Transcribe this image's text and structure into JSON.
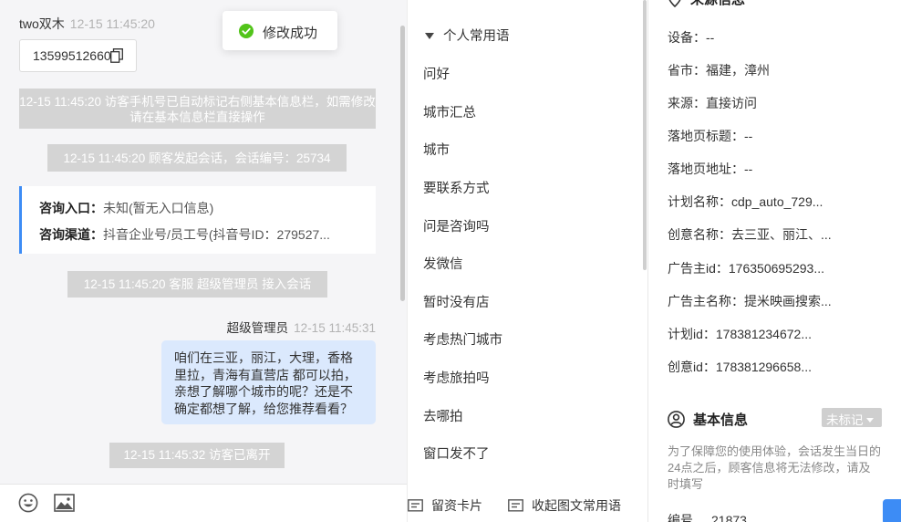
{
  "chat": {
    "visitor_name": "two双木",
    "visitor_time": "12-15 11:45:20",
    "phone": "13599512660",
    "system_messages": [
      "12-15 11:45:20 访客手机号已自动标记右侧基本信息栏，如需修改请在基本信息栏直接操作",
      "12-15 11:45:20 顾客发起会话，会话编号：25734",
      "12-15 11:45:20 客服 超级管理员 接入会话",
      "12-15 11:45:32 访客已离开"
    ],
    "info_card": {
      "entry_label": "咨询入口：",
      "entry_value": "未知(暂无入口信息)",
      "channel_label": "咨询渠道：",
      "channel_value": "抖音企业号/员工号(抖音号ID：279527..."
    },
    "agent_name": "超级管理员",
    "agent_time": "12-15 11:45:31",
    "agent_message": "咱们在三亚，丽江，大理，香格里拉，青海有直营店 都可以拍，亲想了解哪个城市的呢？还是不确定都想了解，给您推荐看看？"
  },
  "toast": {
    "text": "修改成功"
  },
  "icons": {
    "success": "check-circle-icon",
    "copy": "copy-icon",
    "emoji": "emoji-icon",
    "image": "image-icon",
    "card": "card-icon",
    "user": "user-circle-icon"
  },
  "phrases": {
    "group_title": "个人常用语",
    "items": [
      "问好",
      "城市汇总",
      "城市",
      "要联系方式",
      "问是咨询吗",
      "发微信",
      "暂时没有店",
      "考虑热门城市",
      "考虑旅拍吗",
      "去哪拍",
      "窗口发不了"
    ],
    "footer_left": "留资卡片",
    "footer_right": "收起图文常用语"
  },
  "side": {
    "source_title": "来源信息",
    "lines": [
      "设备：--",
      "省市：福建，漳州",
      "来源：直接访问",
      "落地页标题：--",
      "落地页地址：--",
      "计划名称：cdp_auto_729...",
      "创意名称：去三亚、丽江、...",
      "广告主id：176350695293...",
      "广告主名称：提米映画搜索...",
      "计划id：178381234672...",
      "创意id：178381296658..."
    ],
    "basic_title": "基本信息",
    "tag_select": "未标记",
    "notice": "为了保障您的使用体验，会话发生当日的24点之后，顾客信息将无法修改，请及时填写",
    "number_label": "编号",
    "number_value": "21873"
  },
  "colors": {
    "accent": "#3d8cf5",
    "agent_bubble": "#dbe9fd",
    "system_msg": "#d4d4d4",
    "success": "#52c41a"
  }
}
